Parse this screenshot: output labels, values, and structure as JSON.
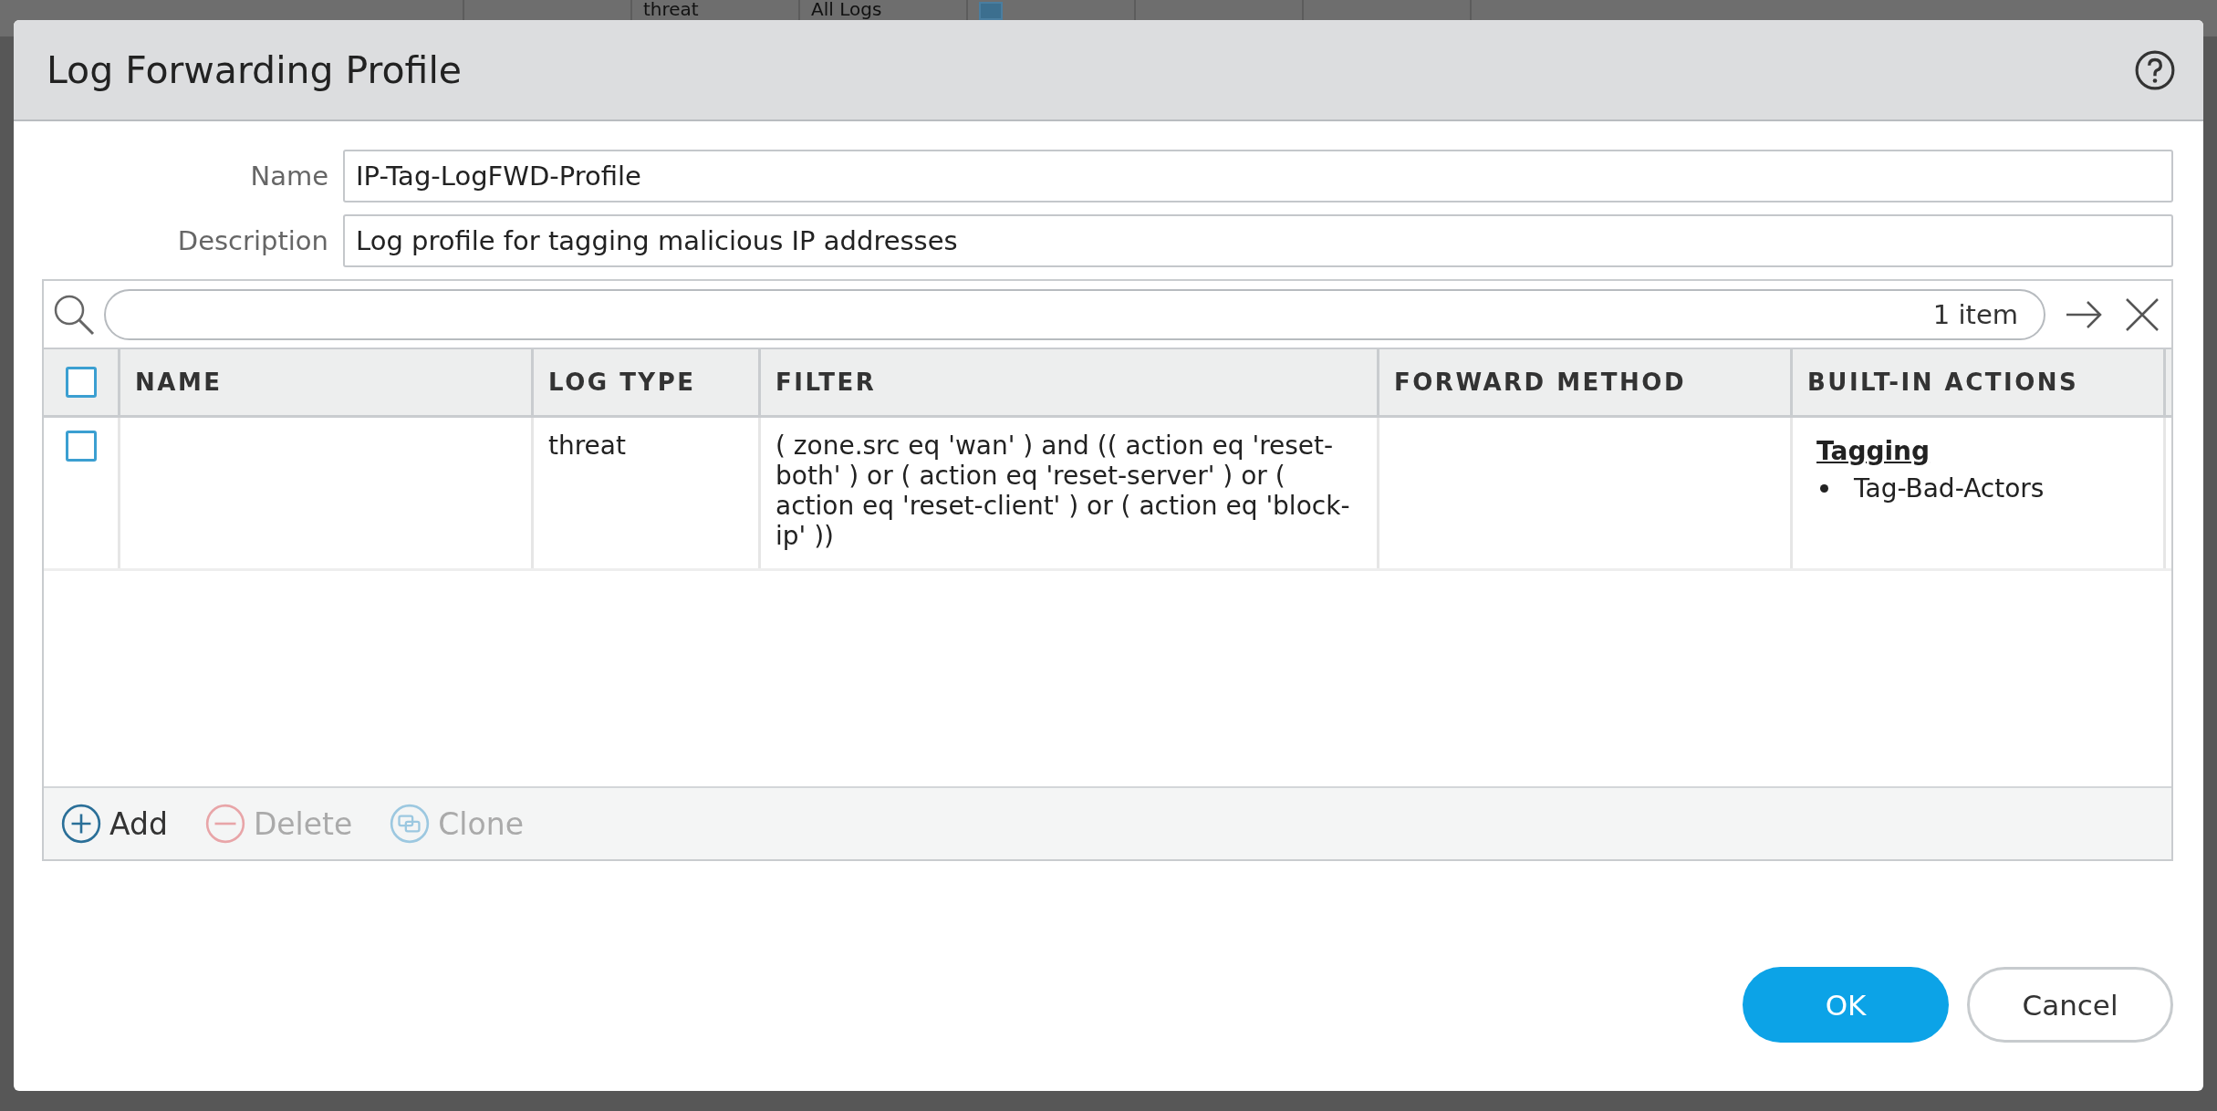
{
  "background": {
    "cells": [
      {
        "text": "threat"
      },
      {
        "text": "All Logs"
      }
    ],
    "checkbox": {
      "checked": true
    }
  },
  "dialog": {
    "title": "Log Forwarding Profile",
    "fields": [
      {
        "label": "Name",
        "value": "IP-Tag-LogFWD-Profile"
      },
      {
        "label": "Description",
        "value": "Log profile for tagging malicious IP addresses"
      }
    ],
    "search": {
      "count": "1 item"
    },
    "table": {
      "header_checkbox": {
        "checked": false
      },
      "columns": [
        "NAME",
        "LOG TYPE",
        "FILTER",
        "FORWARD METHOD",
        "BUILT-IN ACTIONS"
      ],
      "rows": [
        {
          "selected": false,
          "log_type": "threat",
          "filter": "( zone.src eq 'wan' ) and (( action eq 'reset-both' ) or ( action eq 'reset-server' ) or ( action eq 'reset-client' ) or ( action eq 'block-ip' ))",
          "built_in_actions": {
            "heading": "Tagging",
            "items": [
              "Tag-Bad-Actors"
            ]
          }
        }
      ]
    },
    "toolbar": [
      {
        "kind": "add",
        "label": "Add",
        "disabled": false
      },
      {
        "kind": "delete",
        "label": "Delete",
        "disabled": true
      },
      {
        "kind": "clone",
        "label": "Clone",
        "disabled": true
      }
    ],
    "buttons": [
      {
        "kind": "primary",
        "label": "OK"
      },
      {
        "kind": "secondary",
        "label": "Cancel"
      }
    ]
  }
}
